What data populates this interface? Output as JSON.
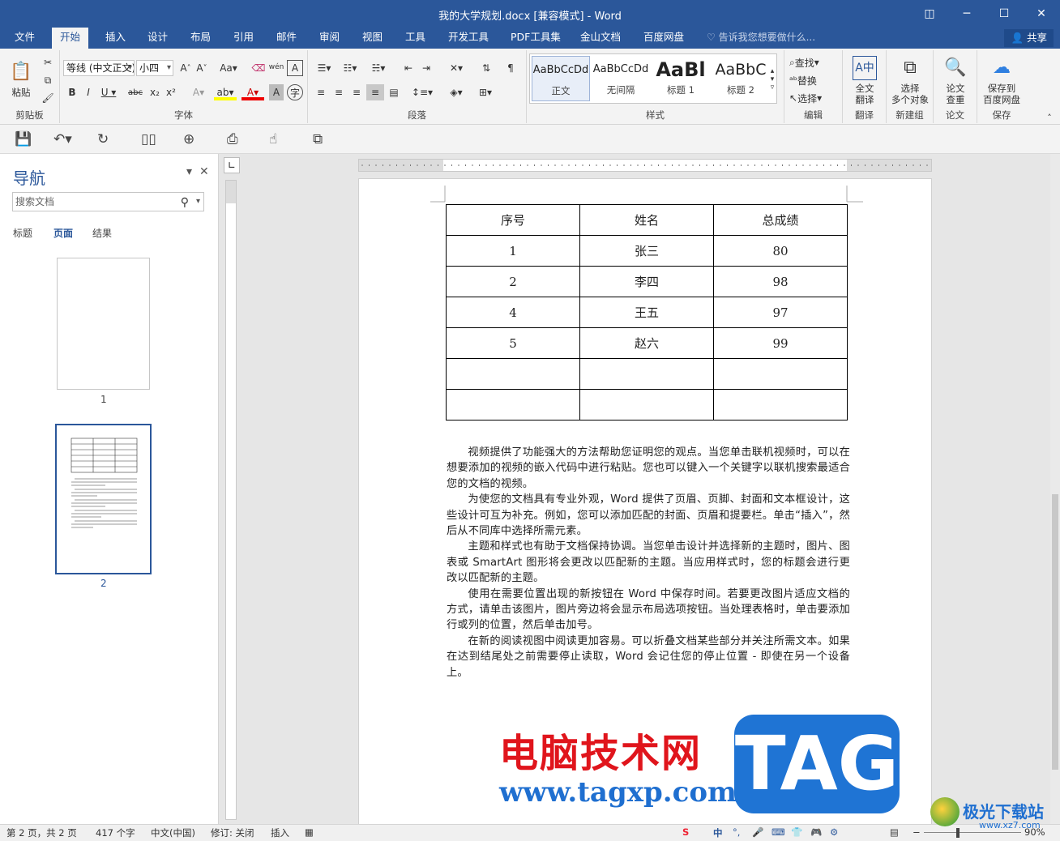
{
  "window": {
    "title": "我的大学规划.docx [兼容模式] - Word",
    "controls": [
      "◫",
      "─",
      "☐",
      "✕"
    ]
  },
  "tabs": [
    "文件",
    "开始",
    "插入",
    "设计",
    "布局",
    "引用",
    "邮件",
    "审阅",
    "视图",
    "工具",
    "开发工具",
    "PDF工具集",
    "金山文档",
    "百度网盘"
  ],
  "active_tab": "开始",
  "tell_me": "告诉我您想要做什么...",
  "share": "共享",
  "ribbon": {
    "clipboard": {
      "paste": "粘贴",
      "label": "剪贴板"
    },
    "font": {
      "name": "等线 (中文正文)",
      "size": "小四",
      "label": "字体"
    },
    "paragraph": {
      "label": "段落"
    },
    "styles": {
      "items": [
        {
          "preview": "AaBbCcDd",
          "name": "正文"
        },
        {
          "preview": "AaBbCcDd",
          "name": "无间隔"
        },
        {
          "preview": "AaBl",
          "name": "标题 1"
        },
        {
          "preview": "AaBbC",
          "name": "标题 2"
        }
      ],
      "label": "样式"
    },
    "editing": {
      "find": "查找",
      "replace": "替换",
      "select": "选择",
      "label": "编辑"
    },
    "translate": {
      "btn": "全文\n翻译",
      "label": "翻译"
    },
    "newgroup": {
      "btn": "选择\n多个对象",
      "label": "新建组"
    },
    "paper": {
      "btn": "论文\n查重",
      "label": "论文"
    },
    "save": {
      "btn": "保存到\n百度网盘",
      "label": "保存"
    }
  },
  "nav": {
    "title": "导航",
    "search_placeholder": "搜索文档",
    "tabs": [
      "标题",
      "页面",
      "结果"
    ],
    "active": "页面",
    "pages": [
      "1",
      "2"
    ]
  },
  "table": {
    "headers": [
      "序号",
      "姓名",
      "总成绩"
    ],
    "rows": [
      [
        "1",
        "张三",
        "80"
      ],
      [
        "2",
        "李四",
        "98"
      ],
      [
        "4",
        "王五",
        "97"
      ],
      [
        "5",
        "赵六",
        "99"
      ],
      [
        "",
        "",
        ""
      ],
      [
        "",
        "",
        ""
      ]
    ]
  },
  "paragraphs": [
    "视频提供了功能强大的方法帮助您证明您的观点。当您单击联机视频时，可以在想要添加的视频的嵌入代码中进行粘贴。您也可以键入一个关键字以联机搜索最适合您的文档的视频。",
    "为使您的文档具有专业外观，Word 提供了页眉、页脚、封面和文本框设计，这些设计可互为补充。例如，您可以添加匹配的封面、页眉和提要栏。单击“插入”，然后从不同库中选择所需元素。",
    "主题和样式也有助于文档保持协调。当您单击设计并选择新的主题时，图片、图表或 SmartArt 图形将会更改以匹配新的主题。当应用样式时，您的标题会进行更改以匹配新的主题。",
    "使用在需要位置出现的新按钮在 Word 中保存时间。若要更改图片适应文档的方式，请单击该图片，图片旁边将会显示布局选项按钮。当处理表格时，单击要添加行或列的位置，然后单击加号。",
    "在新的阅读视图中阅读更加容易。可以折叠文档某些部分并关注所需文本。如果在达到结尾处之前需要停止读取，Word 会记住您的停止位置 - 即使在另一个设备上。"
  ],
  "watermark": {
    "cn": "电脑技术网",
    "url": "www.tagxp.com",
    "tag": "TAG",
    "site2": "极光下载站",
    "site2_url": "www.xz7.com"
  },
  "status": {
    "page": "第 2 页，共 2 页",
    "words": "417 个字",
    "lang": "中文(中国)",
    "track": "修订: 关闭",
    "mode": "插入",
    "zoom": "90%",
    "ime": "中"
  }
}
